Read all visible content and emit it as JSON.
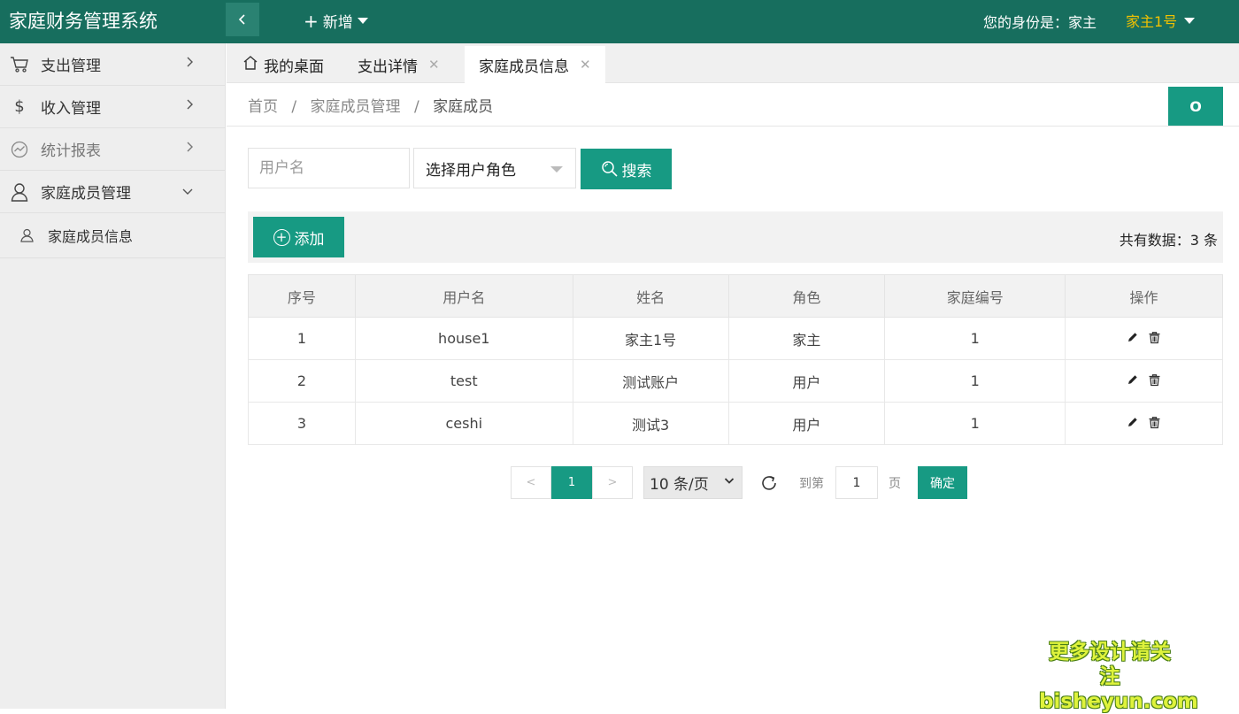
{
  "app": {
    "title": "家庭财务管理系统",
    "new_label": "新增",
    "identity_label": "您的身份是：家主",
    "user_name": "家主1号"
  },
  "colors": {
    "header": "#176e5e",
    "accent": "#179a83",
    "user_name": "#f2c100"
  },
  "sidebar": {
    "items": [
      {
        "label": "支出管理",
        "icon": "cart-icon"
      },
      {
        "label": "收入管理",
        "icon": "dollar-icon"
      },
      {
        "label": "统计报表",
        "icon": "chart-icon"
      },
      {
        "label": "家庭成员管理",
        "icon": "user-icon"
      }
    ],
    "sub_items": [
      {
        "label": "家庭成员信息",
        "icon": "user-icon"
      }
    ]
  },
  "tabs": [
    {
      "label": "我的桌面"
    },
    {
      "label": "支出详情"
    },
    {
      "label": "家庭成员信息"
    }
  ],
  "breadcrumb": {
    "home": "首页",
    "parent": "家庭成员管理",
    "current": "家庭成员",
    "sep": "/"
  },
  "refresh_label": "O",
  "search": {
    "username_placeholder": "用户名",
    "role_label": "选择用户角色",
    "search_label": "搜索"
  },
  "toolbar": {
    "add_label": "添加",
    "total_label": "共有数据：3 条"
  },
  "table": {
    "headers": [
      "序号",
      "用户名",
      "姓名",
      "角色",
      "家庭编号",
      "操作"
    ],
    "rows": [
      [
        "1",
        "house1",
        "家主1号",
        "家主",
        "1"
      ],
      [
        "2",
        "test",
        "测试账户",
        "用户",
        "1"
      ],
      [
        "3",
        "ceshi",
        "测试3",
        "用户",
        "1"
      ]
    ]
  },
  "pagination": {
    "prev": "<",
    "current": "1",
    "next": ">",
    "page_size": "10 条/页",
    "goto_label": "到第",
    "goto_value": "1",
    "page_label": "页",
    "confirm_label": "确定"
  },
  "watermark": {
    "line1": "更多设计请关注",
    "line2": "bisheyun.com"
  }
}
